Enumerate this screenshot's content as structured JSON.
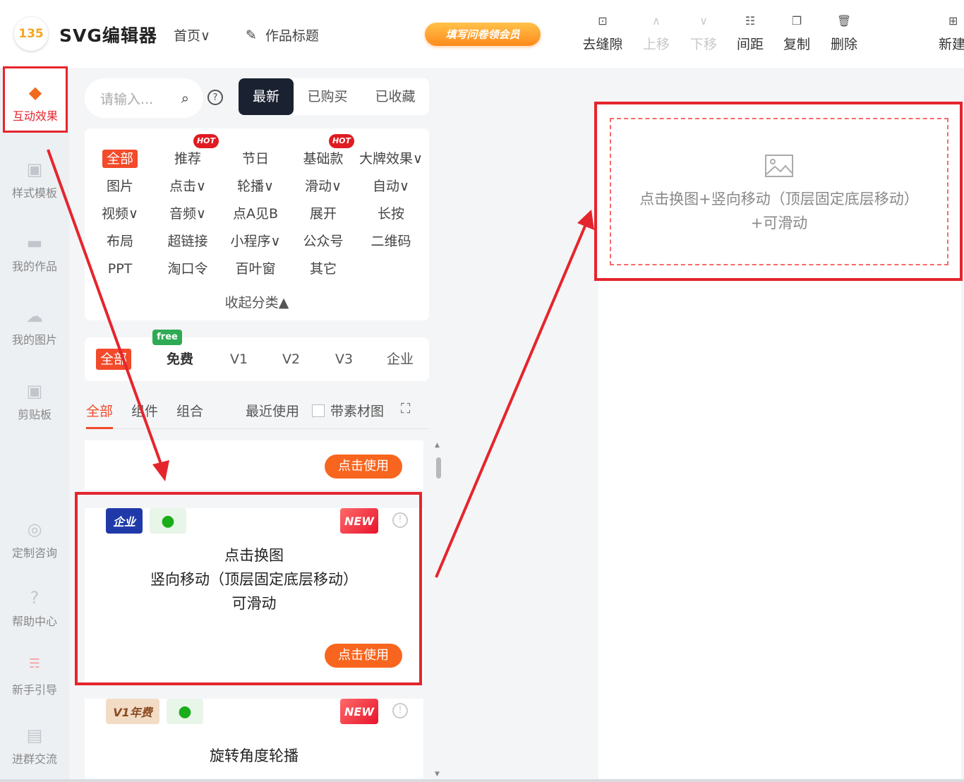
{
  "header": {
    "logo": "135",
    "app_title": "SVG编辑器",
    "nav_home": "首页",
    "nav_work_title": "作品标题",
    "promo": "填写问卷领会员",
    "tools": [
      {
        "label": "去缝隙",
        "icon": "gap-icon",
        "disabled": false
      },
      {
        "label": "上移",
        "icon": "chevron-up-icon",
        "disabled": true
      },
      {
        "label": "下移",
        "icon": "chevron-down-icon",
        "disabled": true
      },
      {
        "label": "间距",
        "icon": "spacing-icon",
        "disabled": false
      },
      {
        "label": "复制",
        "icon": "copy-icon",
        "disabled": false
      },
      {
        "label": "删除",
        "icon": "trash-icon",
        "disabled": false
      },
      {
        "label": "新建",
        "icon": "new-icon",
        "disabled": false
      }
    ]
  },
  "sidebar": {
    "items": [
      {
        "label": "互动效果",
        "icon": "cube-icon",
        "active": true
      },
      {
        "label": "样式模板",
        "icon": "template-icon"
      },
      {
        "label": "我的作品",
        "icon": "folder-icon"
      },
      {
        "label": "我的图片",
        "icon": "cloud-icon"
      },
      {
        "label": "剪贴板",
        "icon": "clipboard-icon"
      },
      {
        "label": "定制咨询",
        "icon": "headset-icon"
      },
      {
        "label": "帮助中心",
        "icon": "help-icon"
      },
      {
        "label": "新手引导",
        "icon": "guide-icon"
      },
      {
        "label": "进群交流",
        "icon": "doc-icon"
      }
    ]
  },
  "panel": {
    "search_placeholder": "请输入...",
    "help": "?",
    "top_tabs": [
      "最新",
      "已购买",
      "已收藏"
    ],
    "categories": [
      {
        "label": "全部",
        "active": true
      },
      {
        "label": "推荐",
        "hot": true
      },
      {
        "label": "节日"
      },
      {
        "label": "基础款",
        "hot": true
      },
      {
        "label": "大牌效果∨"
      },
      {
        "label": "图片"
      },
      {
        "label": "点击∨"
      },
      {
        "label": "轮播∨"
      },
      {
        "label": "滑动∨"
      },
      {
        "label": "自动∨"
      },
      {
        "label": "视频∨"
      },
      {
        "label": "音频∨"
      },
      {
        "label": "点A见B"
      },
      {
        "label": "展开"
      },
      {
        "label": "长按"
      },
      {
        "label": "布局"
      },
      {
        "label": "超链接"
      },
      {
        "label": "小程序∨"
      },
      {
        "label": "公众号"
      },
      {
        "label": "二维码"
      },
      {
        "label": "PPT"
      },
      {
        "label": "淘口令"
      },
      {
        "label": "百叶窗"
      },
      {
        "label": "其它"
      }
    ],
    "hot_label": "HOT",
    "collapse": "收起分类",
    "free_label": "free",
    "level_tabs": [
      "全部",
      "免费",
      "V1",
      "V2",
      "V3",
      "企业"
    ],
    "type_tabs": [
      "全部",
      "组件",
      "组合"
    ],
    "recent": "最近使用",
    "with_material": "带素材图",
    "cards": [
      {
        "button": "点击使用"
      },
      {
        "badges": [
          "企业",
          "WeChat"
        ],
        "new": "NEW",
        "title_lines": [
          "点击换图",
          "竖向移动（顶层固定底层移动）",
          "可滑动"
        ],
        "button": "点击使用"
      },
      {
        "badges": [
          "V1年费",
          "WeChat"
        ],
        "new": "NEW",
        "title_lines": [
          "旋转角度轮播"
        ]
      }
    ]
  },
  "canvas": {
    "placeholder_lines": [
      "点击换图+竖向移动（顶层固定底层移动）",
      "+可滑动"
    ]
  },
  "colors": {
    "accent": "#f24a2a",
    "annotation": "#e5252d",
    "dark": "#1a2231"
  }
}
